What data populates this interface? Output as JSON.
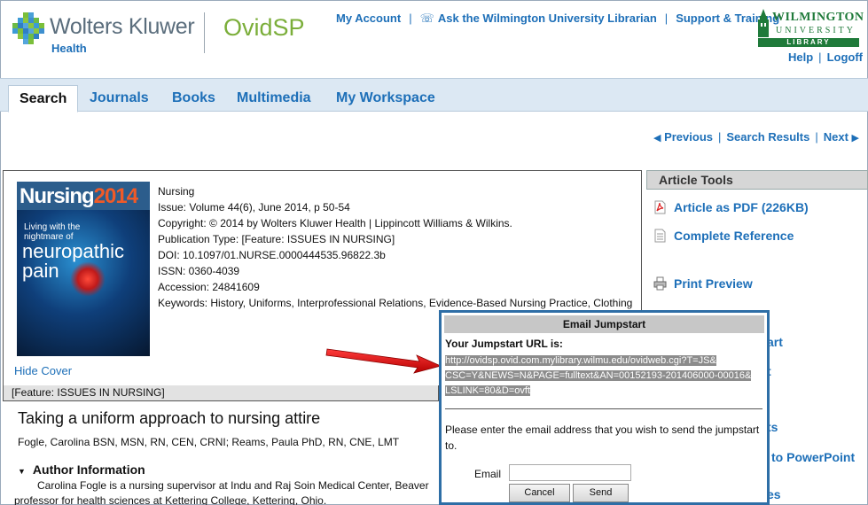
{
  "header": {
    "brand_name": "Wolters Kluwer",
    "brand_sub": "Health",
    "product": "OvidSP",
    "links": [
      "My Account",
      "Ask the Wilmington University Librarian",
      "Support & Training"
    ],
    "help_links": [
      "Help",
      "Logoff"
    ],
    "university": {
      "line1": "WILMINGTON",
      "line2": "UNIVERSITY",
      "line3": "LIBRARY"
    }
  },
  "tabs": [
    {
      "label": "Search",
      "active": true
    },
    {
      "label": "Journals"
    },
    {
      "label": "Books"
    },
    {
      "label": "Multimedia"
    },
    {
      "label": "My Workspace"
    }
  ],
  "pager": {
    "previous": "Previous",
    "results": "Search Results",
    "next": "Next"
  },
  "cover": {
    "masthead": "Nursing",
    "year": "2014",
    "headline1": "Living with the",
    "headline2": "nightmare of",
    "big": "neuropathic",
    "big2": "pain"
  },
  "article": {
    "journal": "Nursing",
    "issue": "Issue: Volume 44(6), June 2014, p 50-54",
    "copyright": "Copyright: © 2014 by Wolters Kluwer Health | Lippincott Williams & Wilkins.",
    "pubtype": "Publication Type: [Feature: ISSUES IN NURSING]",
    "doi": "DOI: 10.1097/01.NURSE.0000444535.96822.3b",
    "issn": "ISSN: 0360-4039",
    "accession": "Accession: 24841609",
    "keywords": "Keywords: History, Uniforms, Interprofessional Relations, Evidence-Based Nursing Practice, Clothing",
    "hide_cover": "Hide Cover",
    "section": "[Feature: ISSUES IN NURSING]",
    "title": "Taking a uniform approach to nursing attire",
    "authors": "Fogle, Carolina BSN, MSN, RN, CEN, CRNI; Reams, Paula PhD, RN, CNE, LMT",
    "author_info_label": "Author Information",
    "author_line1": "Carolina Fogle is a nursing supervisor at Indu and Raj Soin Medical Center, Beaver",
    "author_line2": "professor for health sciences at Kettering College, Kettering, Ohio."
  },
  "tools": {
    "heading": "Article Tools",
    "items": [
      "Article as PDF (226KB)",
      "Complete Reference",
      "Print Preview",
      "Email Jumpstart",
      "Email Jumpstart",
      "Find Citing Articles",
      "to PowerPoint",
      "es"
    ],
    "visible_items": [
      {
        "label": "Article as PDF (226KB)"
      },
      {
        "label": "Complete Reference"
      },
      {
        "label": "Print Preview"
      },
      {
        "label": "art"
      },
      {
        "label": "t"
      },
      {
        "label": "ts"
      },
      {
        "label": "to PowerPoint"
      },
      {
        "label": "es"
      }
    ]
  },
  "popup": {
    "title": "Email Jumpstart",
    "label": "Your Jumpstart URL is:",
    "url_lines": [
      "http://ovidsp.ovid.com.mylibrary.wilmu.edu/ovidweb.cgi?T=JS&",
      "CSC=Y&NEWS=N&PAGE=fulltext&AN=00152193-201406000-00016&",
      "LSLINK=80&D=ovft"
    ],
    "message": "Please enter the email address that you wish to send the jumpstart to.",
    "email_label": "Email",
    "email_value": "",
    "cancel": "Cancel",
    "send": "Send"
  }
}
